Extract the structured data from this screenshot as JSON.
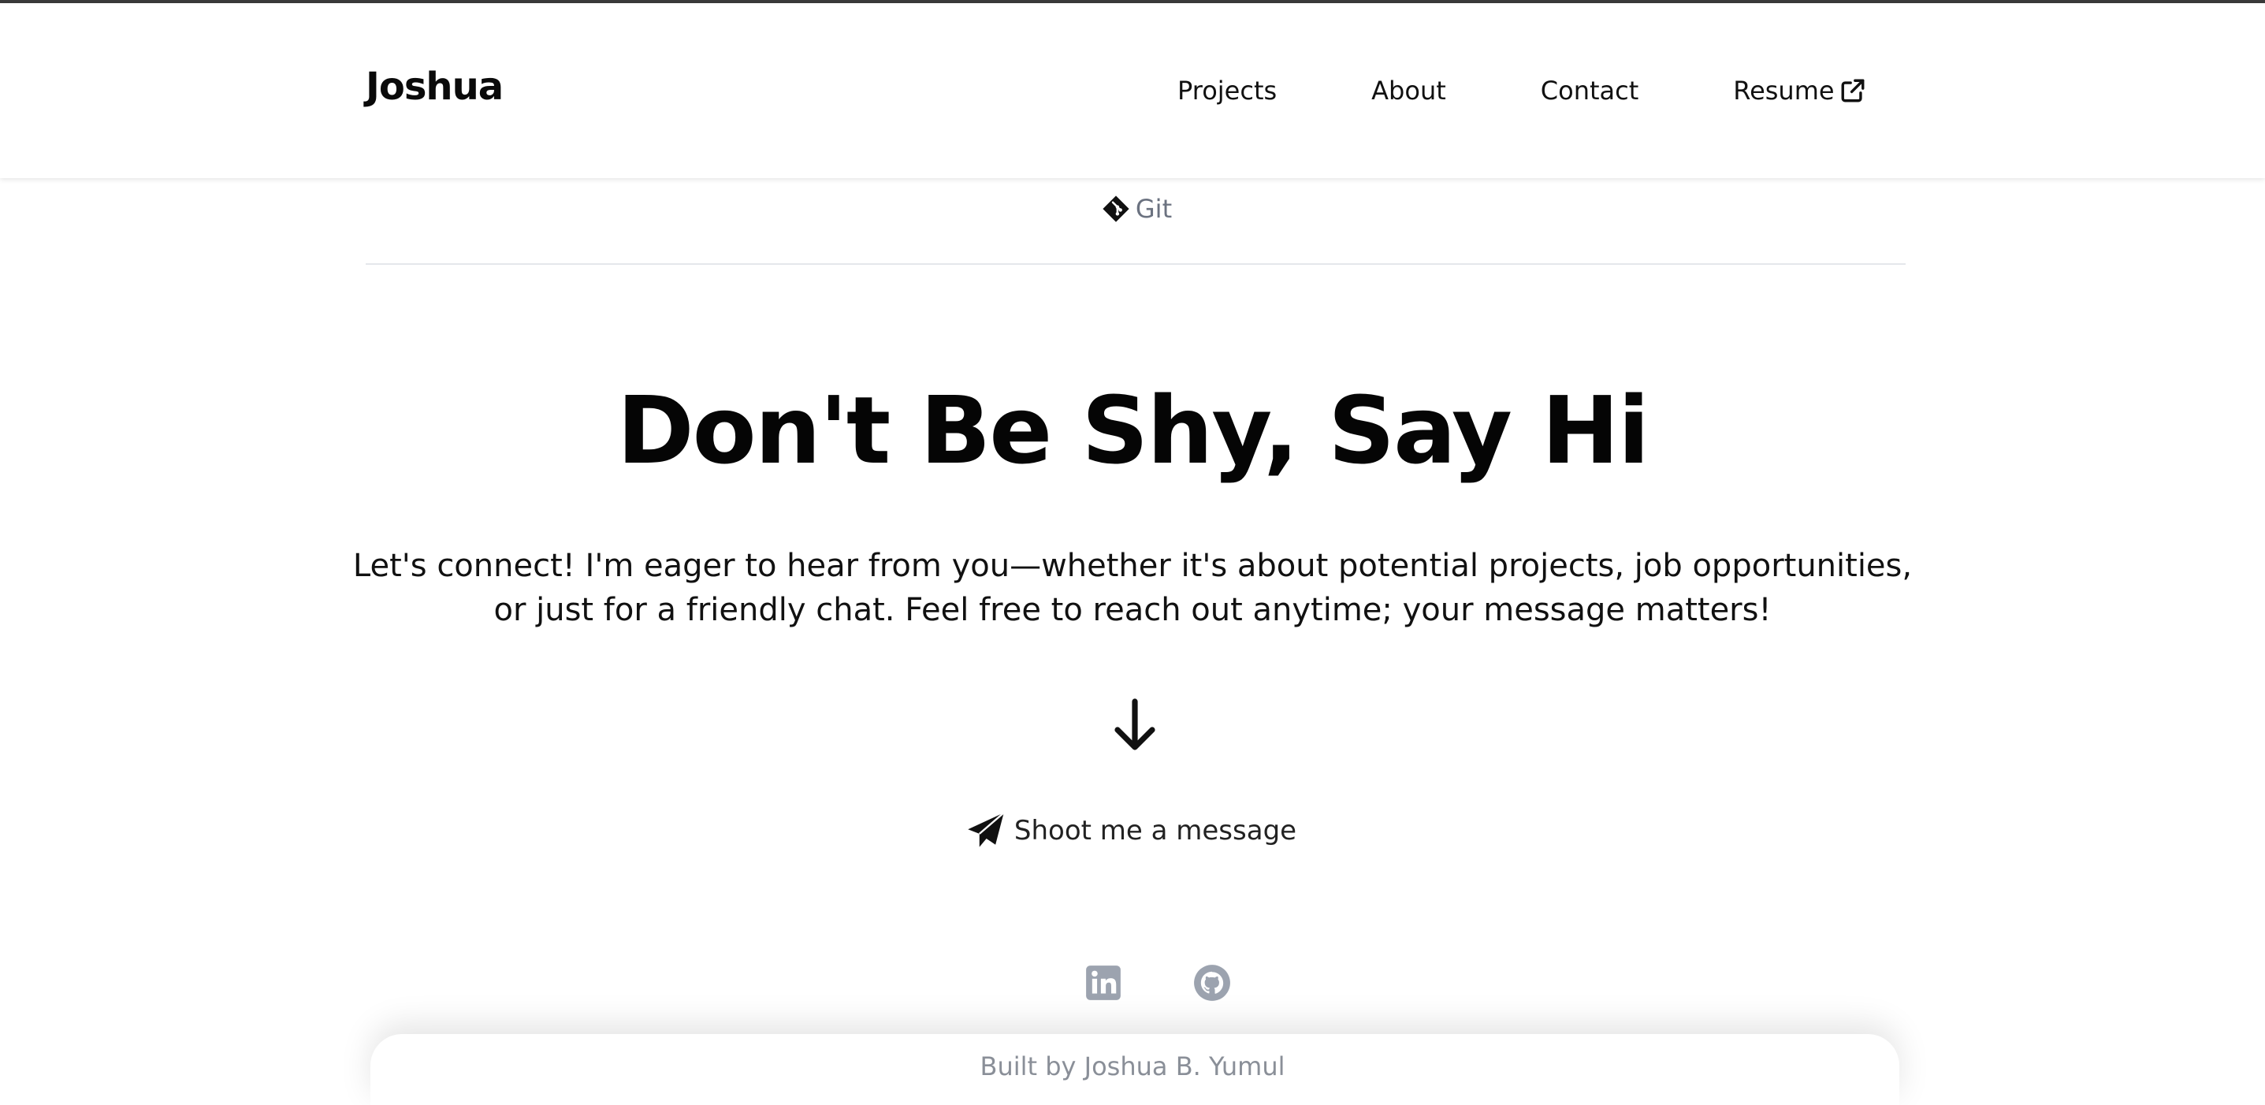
{
  "navbar": {
    "brand": "Joshua",
    "links": [
      {
        "label": "Projects"
      },
      {
        "label": "About"
      },
      {
        "label": "Contact"
      },
      {
        "label": "Resume",
        "icon": "external-link-icon"
      }
    ]
  },
  "tech_item": {
    "label": "Git",
    "icon": "git-icon"
  },
  "hero": {
    "title": "Don't Be Shy, Say Hi",
    "text_line1": "Let's connect! I'm eager to hear from you—whether it's about potential projects, job opportunities,",
    "text_line2": "or just for a friendly chat. Feel free to reach out anytime; your message matters!",
    "arrow_icon": "arrow-down-icon"
  },
  "cta": {
    "label": "Shoot me a message",
    "icon": "paper-plane-icon"
  },
  "social": [
    {
      "name": "linkedin-icon"
    },
    {
      "name": "github-icon"
    }
  ],
  "footer": {
    "text": "Built by Joshua B. Yumul"
  },
  "colors": {
    "text": "#111111",
    "muted": "#6b7280",
    "footer_text": "#8a8f98",
    "icon_gray": "#9ca3af",
    "divider": "#e5e7eb"
  }
}
